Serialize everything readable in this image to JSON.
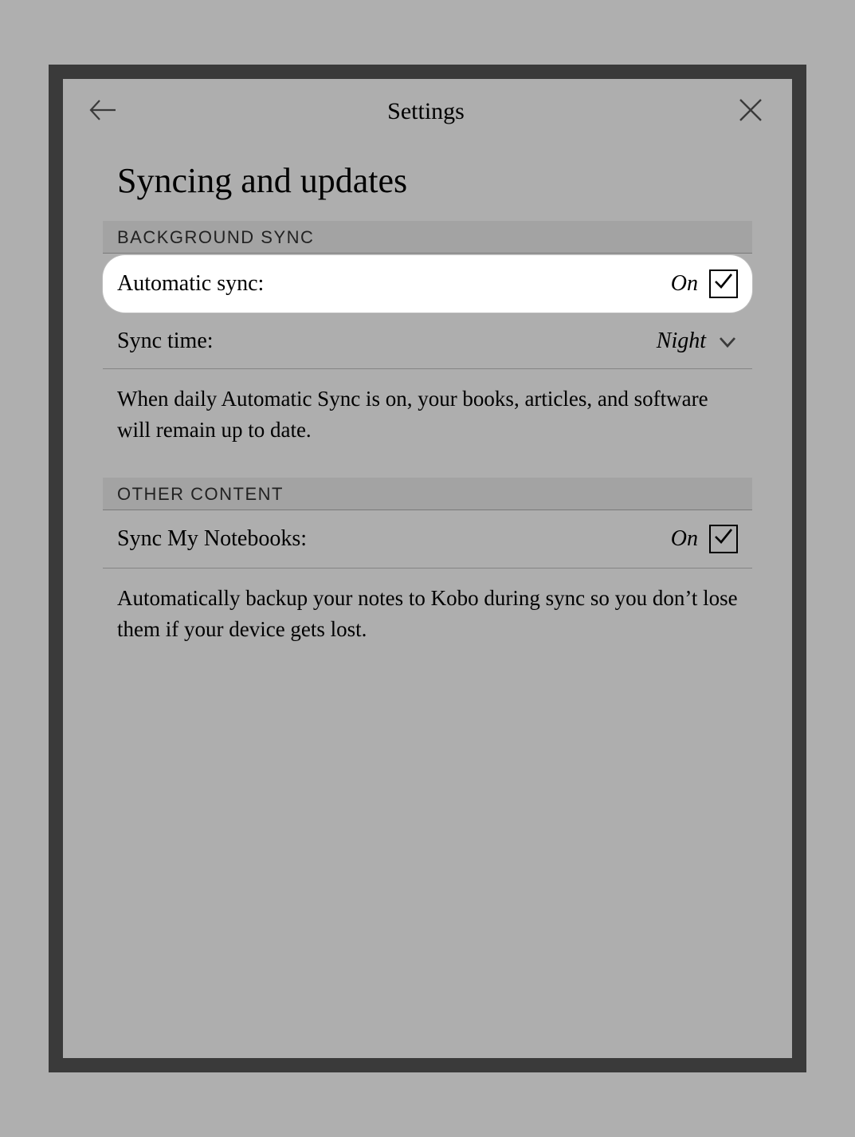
{
  "header": {
    "title": "Settings"
  },
  "page": {
    "title": "Syncing and updates"
  },
  "sections": {
    "background_sync": {
      "header": "BACKGROUND SYNC",
      "automatic_sync": {
        "label": "Automatic sync:",
        "value": "On"
      },
      "sync_time": {
        "label": "Sync time:",
        "value": "Night"
      },
      "description": "When daily Automatic Sync is on, your books, articles, and software will remain up to date."
    },
    "other_content": {
      "header": "OTHER CONTENT",
      "sync_notebooks": {
        "label": "Sync My Notebooks:",
        "value": "On"
      },
      "description": "Automatically backup your notes to Kobo during sync so you don’t lose them if your device gets lost."
    }
  }
}
